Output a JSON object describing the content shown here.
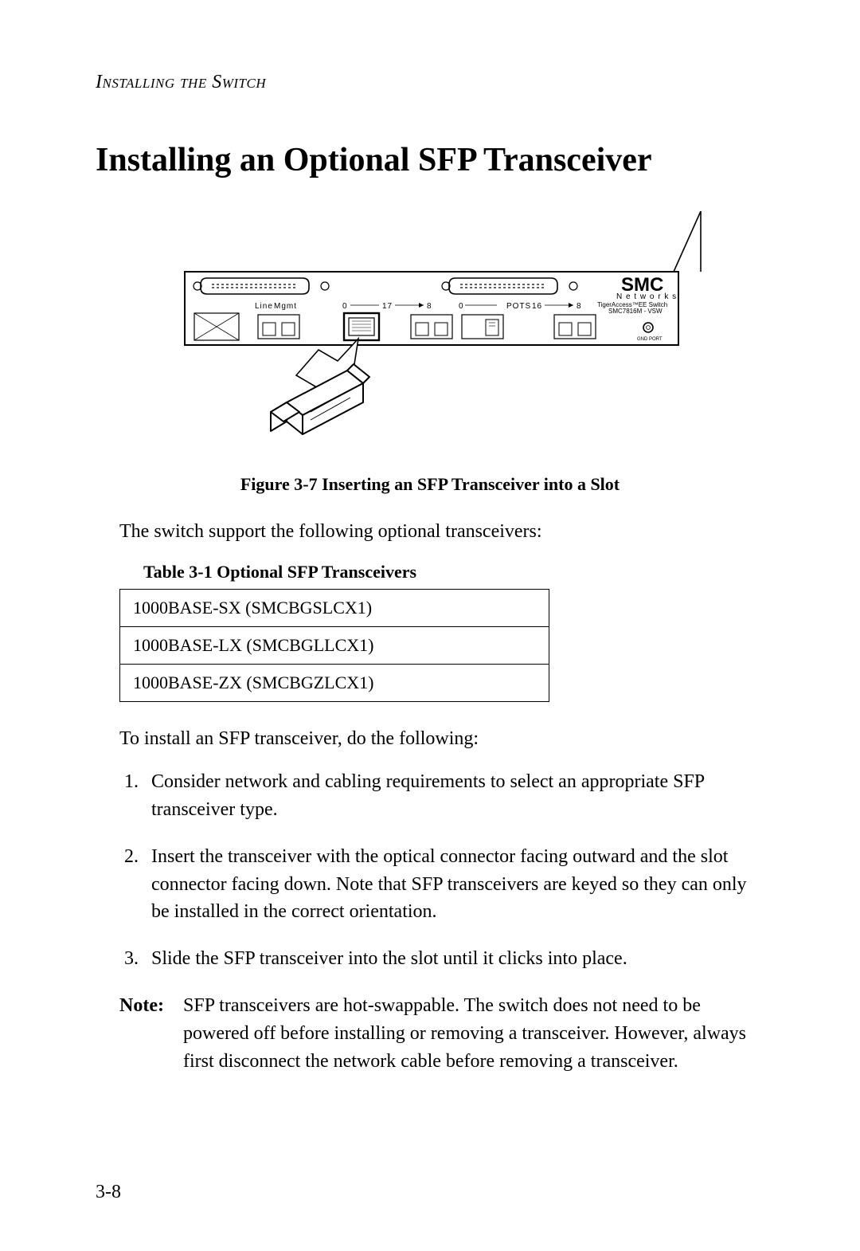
{
  "running_head": "Installing the Switch",
  "title": "Installing an Optional SFP Transceiver",
  "figure": {
    "caption": "Figure 3-7  Inserting an SFP Transceiver into a Slot",
    "brand": "SMC",
    "brand_sub": "N e t w o r k s",
    "brand_line1": "TigerAccess™EE Switch",
    "brand_line2": "SMC7816M - VSW",
    "label_line": "Line",
    "label_mgmt": "Mgmt",
    "label_pots": "POTS",
    "label_gnd": "GND PORT",
    "range1_a": "0",
    "range1_b": "17",
    "range1_c": "8",
    "range2_a": "0",
    "range2_b": "16",
    "range2_c": "8"
  },
  "intro": "The switch support the following optional transceivers:",
  "table": {
    "caption": "Table 3-1  Optional SFP Transceivers",
    "rows": [
      "1000BASE-SX (SMCBGSLCX1)",
      "1000BASE-LX (SMCBGLLCX1)",
      "1000BASE-ZX (SMCBGZLCX1)"
    ]
  },
  "lead": "To install an SFP transceiver, do the following:",
  "steps": [
    "Consider network and cabling requirements to select an appropriate SFP transceiver type.",
    "Insert the transceiver with the optical connector facing outward and the slot connector facing down. Note that SFP transceivers are keyed so they can only be installed in the correct orientation.",
    "Slide the SFP transceiver into the slot until it clicks into place."
  ],
  "note": {
    "label": "Note:",
    "text": "SFP transceivers are hot-swappable. The switch does not need to be powered off before installing or removing a transceiver. However, always first disconnect the network cable before removing a transceiver."
  },
  "page_number": "3-8"
}
